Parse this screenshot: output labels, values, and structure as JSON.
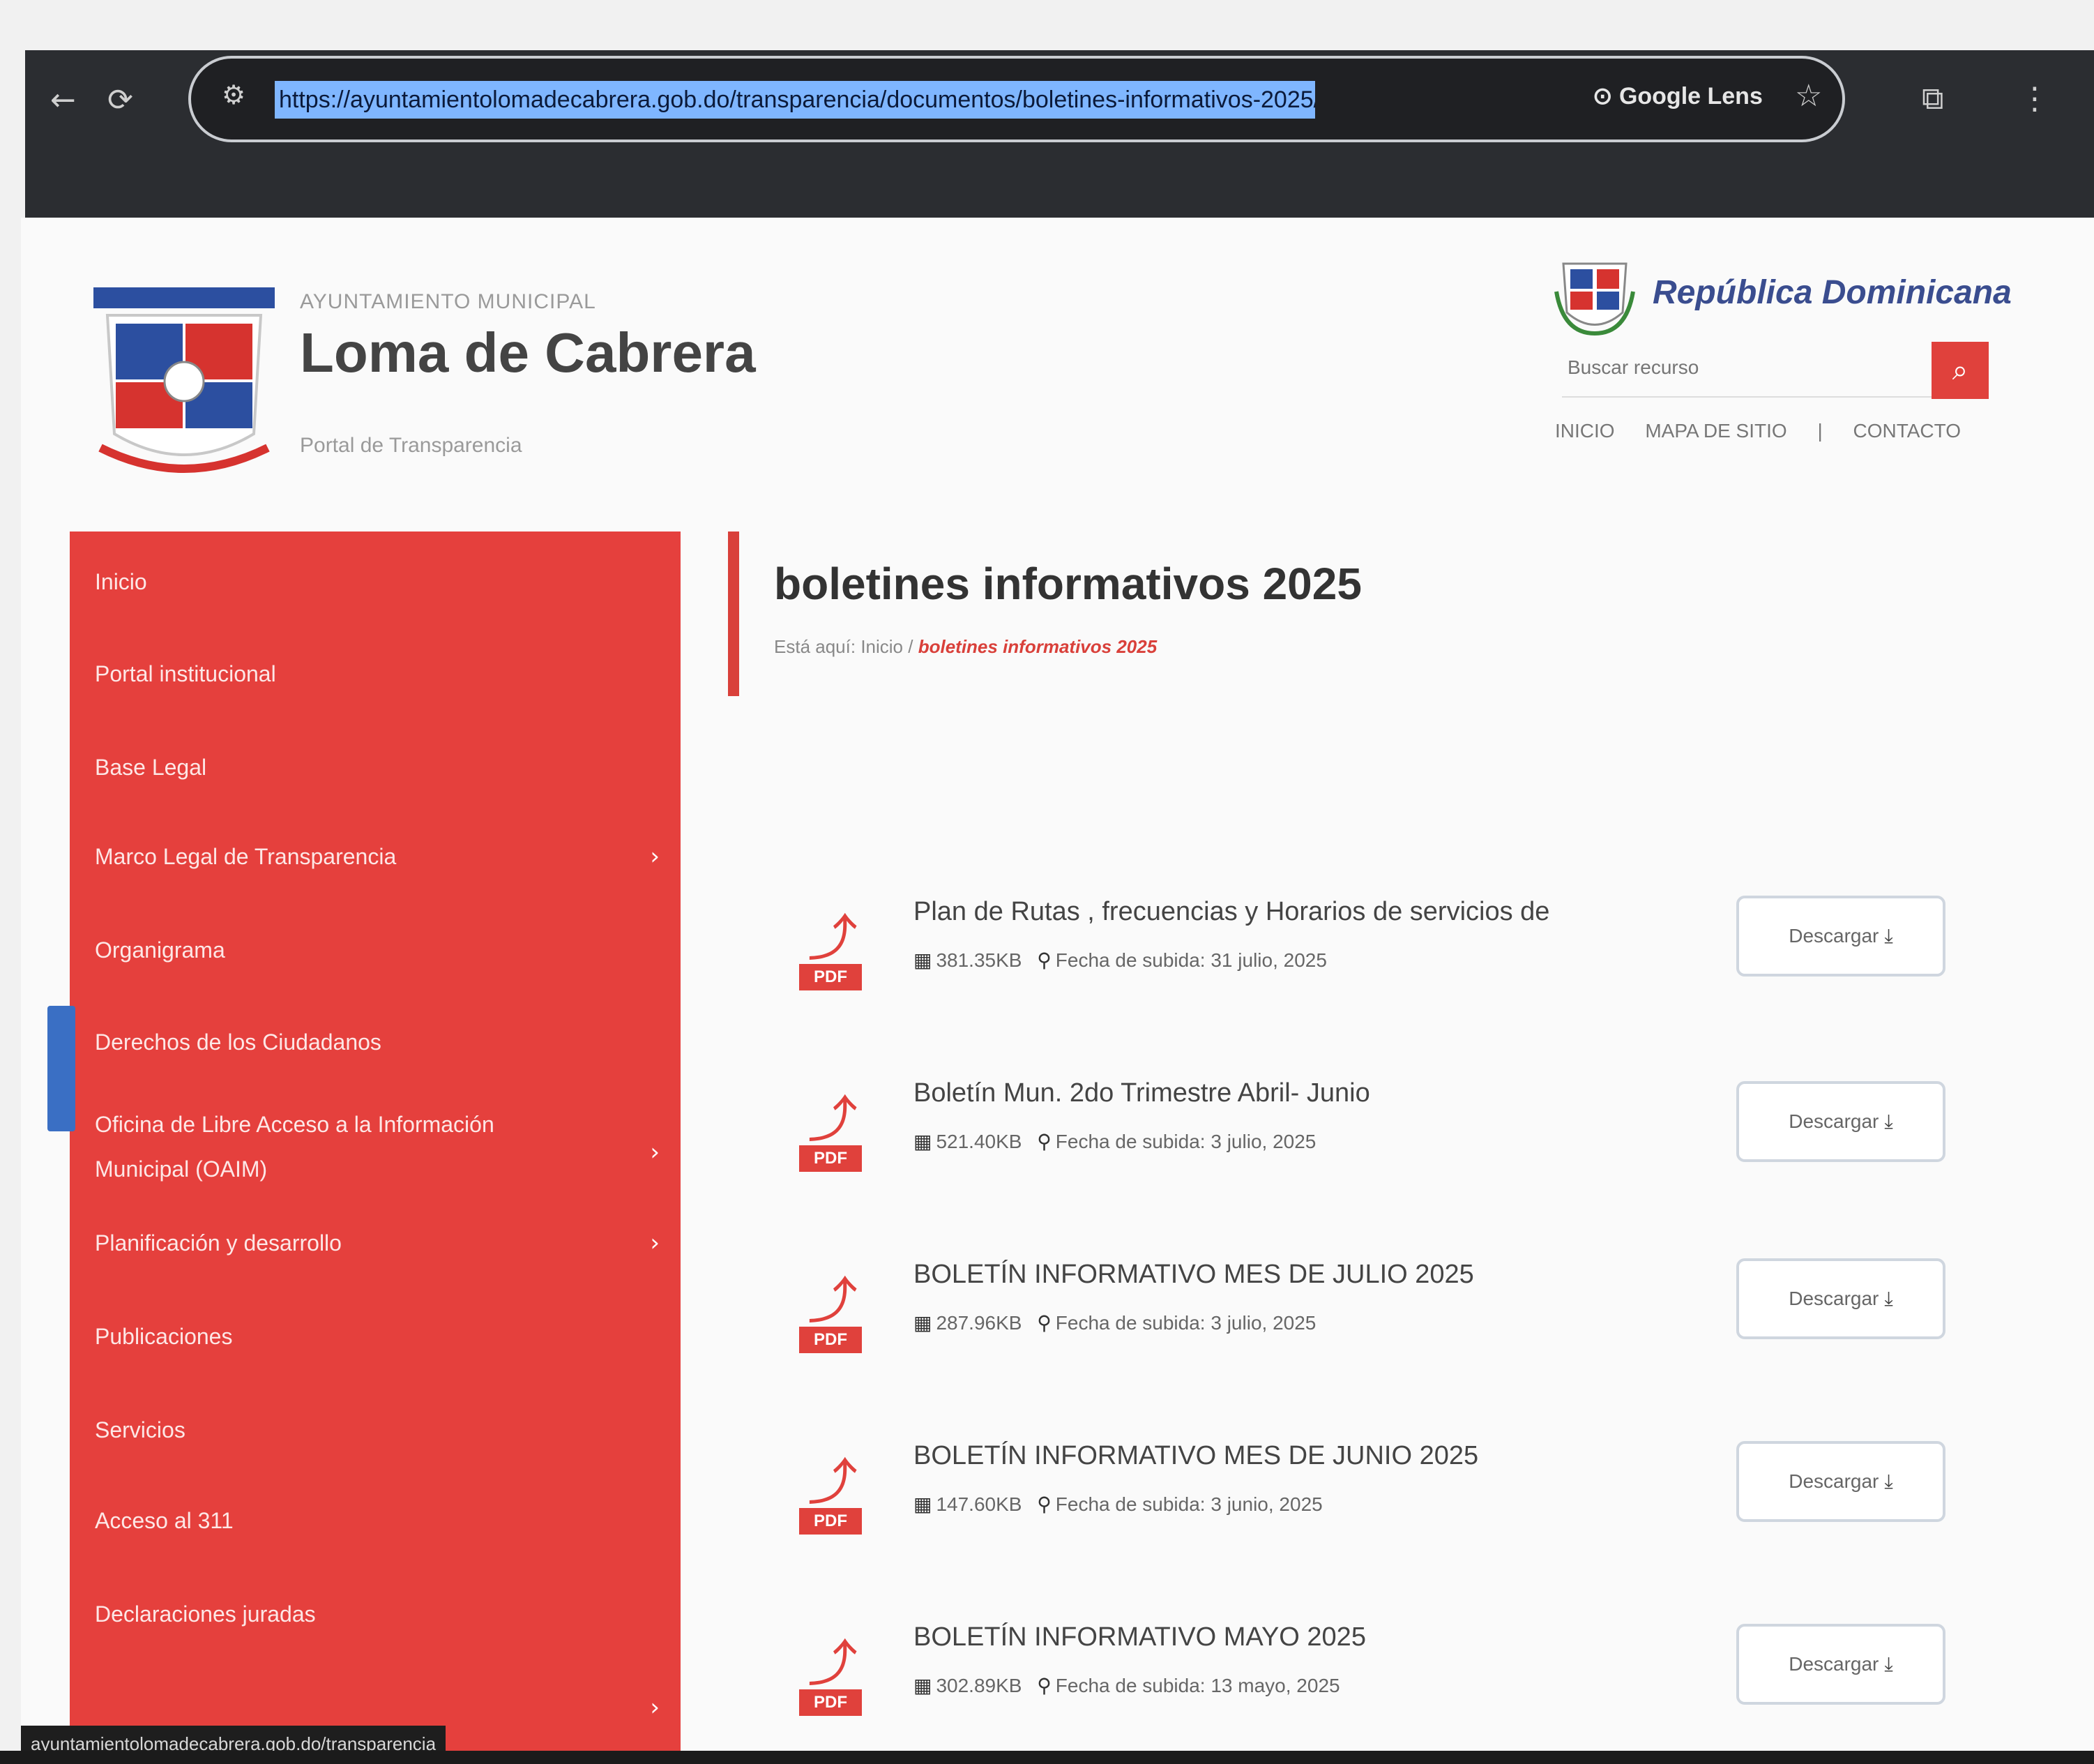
{
  "browser": {
    "url": "https://ayuntamientolomadecabrera.gob.do/transparencia/documentos/boletines-informativos-2025/",
    "lens_label": "Google Lens",
    "back_icon": "arrow-left-icon",
    "reload_icon": "reload-icon",
    "star_icon": "star-icon"
  },
  "header": {
    "small_text": "AYUNTAMIENTO MUNICIPAL",
    "title": "Loma de Cabrera",
    "subtitle": "Portal de Transparencia",
    "country": "República Dominicana",
    "search_placeholder": "Buscar recurso",
    "links": [
      "INICIO",
      "MAPA DE SITIO",
      "|",
      "CONTACTO"
    ]
  },
  "sidebar": {
    "items": [
      {
        "label": "Inicio",
        "has_children": false
      },
      {
        "label": "Portal institucional",
        "has_children": false
      },
      {
        "label": "Base Legal",
        "has_children": false
      },
      {
        "label": "Marco Legal de Transparencia",
        "has_children": true
      },
      {
        "label": "Organigrama",
        "has_children": false
      },
      {
        "label": "Derechos de los Ciudadanos",
        "has_children": false
      },
      {
        "label": "Oficina de Libre Acceso a la Información Municipal (OAIM)",
        "has_children": true
      },
      {
        "label": "Planificación y desarrollo",
        "has_children": true
      },
      {
        "label": "Publicaciones",
        "has_children": false
      },
      {
        "label": "Servicios",
        "has_children": false
      },
      {
        "label": "Acceso al 311",
        "has_children": false
      },
      {
        "label": "Declaraciones juradas",
        "has_children": false
      }
    ]
  },
  "main": {
    "title": "boletines informativos 2025",
    "breadcrumb": {
      "prefix": "Está aquí:",
      "home": "Inicio",
      "sep": "/",
      "current": "boletines informativos 2025"
    },
    "pdf_label": "PDF",
    "upload_prefix": "Fecha de subida:",
    "download_label": "Descargar",
    "documents": [
      {
        "title": "Plan de Rutas , frecuencias y Horarios de servicios de",
        "size": "381.35KB",
        "date": "31 julio, 2025"
      },
      {
        "title": "Boletín Mun. 2do Trimestre Abril- Junio",
        "size": "521.40KB",
        "date": "3 julio, 2025"
      },
      {
        "title": "BOLETÍN INFORMATIVO MES DE JULIO 2025",
        "size": "287.96KB",
        "date": "3 julio, 2025"
      },
      {
        "title": "BOLETÍN INFORMATIVO MES DE JUNIO 2025",
        "size": "147.60KB",
        "date": "3 junio, 2025"
      },
      {
        "title": "BOLETÍN INFORMATIVO MAYO 2025",
        "size": "302.89KB",
        "date": "13 mayo, 2025"
      }
    ]
  },
  "status_bar": "ayuntamientolomadecabrera.gob.do/transparencia",
  "colors": {
    "accent_red": "#e5403d",
    "title_red": "#d9403a",
    "link_blue": "#3a4d8f"
  }
}
